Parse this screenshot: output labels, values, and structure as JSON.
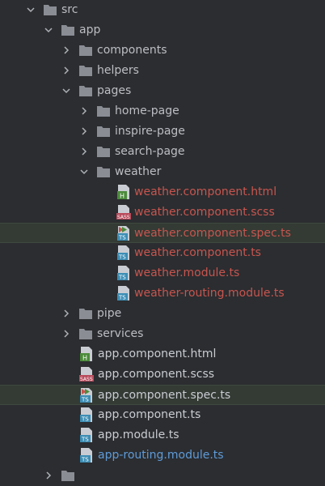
{
  "colors": {
    "background": "#2b2d30",
    "folder": "#8a8d94",
    "modified_text": "#c7554f",
    "new_text": "#5f9bd8",
    "html_badge": "#4b8b3b",
    "sass_badge": "#b84b5c",
    "ts_badge": "#3d8eb5"
  },
  "tree": {
    "src": "src",
    "app": "app",
    "components": "components",
    "helpers": "helpers",
    "pages": "pages",
    "home_page": "home-page",
    "inspire_page": "inspire-page",
    "search_page": "search-page",
    "weather": "weather",
    "weather_files": {
      "html": "weather.component.html",
      "scss": "weather.component.scss",
      "spec": "weather.component.spec.ts",
      "ts": "weather.component.ts",
      "module": "weather.module.ts",
      "routing": "weather-routing.module.ts"
    },
    "pipe": "pipe",
    "services": "services",
    "app_files": {
      "html": "app.component.html",
      "scss": "app.component.scss",
      "spec": "app.component.spec.ts",
      "ts": "app.component.ts",
      "module": "app.module.ts",
      "routing": "app-routing.module.ts"
    }
  },
  "badges": {
    "html": "H",
    "sass": "SASS",
    "ts": "TS"
  }
}
